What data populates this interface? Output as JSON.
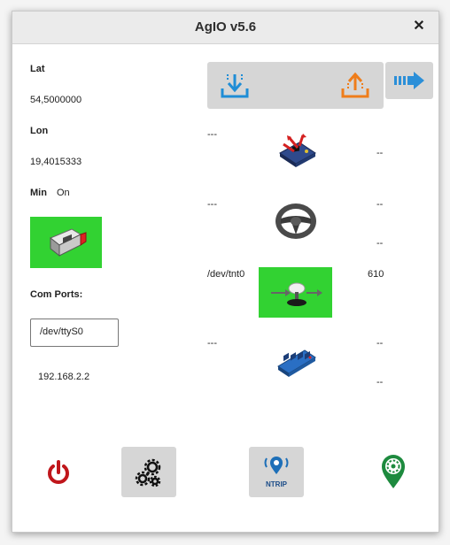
{
  "window": {
    "title": "AgIO v5.6",
    "close_glyph": "✕"
  },
  "left": {
    "lat_label": "Lat",
    "lat_value": "54,5000000",
    "lon_label": "Lon",
    "lon_value": "19,4015333",
    "min_label": "Min",
    "min_value": "On",
    "ethernet_icon": "ethernet-connector-icon",
    "com_ports_label": "Com Ports:",
    "com_port_value": "/dev/ttyS0",
    "ip_address": "192.168.2.2"
  },
  "right": {
    "download_icon": "download-icon",
    "upload_icon": "upload-icon",
    "arrow_icon": "arrow-right-icon",
    "imu": {
      "left": "---",
      "right": "--",
      "icon": "imu-board-icon"
    },
    "steer": {
      "left": "---",
      "right": "--",
      "right2": "--",
      "icon": "steering-wheel-icon"
    },
    "gps": {
      "left": "/dev/tnt0",
      "right": "610",
      "icon": "gps-antenna-icon"
    },
    "machine": {
      "left": "---",
      "right": "--",
      "right2": "--",
      "icon": "relay-board-icon"
    }
  },
  "bottom": {
    "power_icon": "power-icon",
    "settings_icon": "gears-icon",
    "ntrip_label": "NTRIP",
    "location_icon": "map-pin-icon"
  },
  "colors": {
    "status_green": "#32d232",
    "power_red": "#c0161b",
    "blue": "#2b8fd8",
    "orange": "#ef7d1a",
    "pin_green": "#1d8a3e"
  }
}
